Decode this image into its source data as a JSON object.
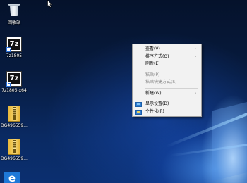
{
  "desktop": {
    "icons": [
      {
        "label": "回收站",
        "icon": "recycle-bin-icon"
      },
      {
        "label": "7z1805",
        "icon": "7zip-icon"
      },
      {
        "label": "7z1805-x64",
        "icon": "7zip-icon"
      },
      {
        "label": "DG496559...",
        "icon": "zip-archive-icon"
      },
      {
        "label": "DG496559...",
        "icon": "zip-archive-icon"
      },
      {
        "label": "",
        "icon": "edge-icon"
      }
    ]
  },
  "context_menu": {
    "items": [
      {
        "label": "查看(V)",
        "submenu": true,
        "disabled": false
      },
      {
        "label": "排序方式(O)",
        "submenu": true,
        "disabled": false
      },
      {
        "label": "刷新(E)",
        "submenu": false,
        "disabled": false
      },
      {
        "label": "粘贴(P)",
        "submenu": false,
        "disabled": true
      },
      {
        "label": "粘贴快捷方式(S)",
        "submenu": false,
        "disabled": true
      },
      {
        "label": "新建(W)",
        "submenu": true,
        "disabled": false
      },
      {
        "label": "显示设置(D)",
        "submenu": false,
        "disabled": false,
        "icon": "display-settings-icon"
      },
      {
        "label": "个性化(R)",
        "submenu": false,
        "disabled": false,
        "icon": "personalize-icon"
      }
    ],
    "arrow_glyph": "›"
  },
  "colors": {
    "desktop_dark": "#05122b",
    "desktop_light": "#0b2f70",
    "menu_bg": "#f2f2f2",
    "menu_disabled": "#8a8a8a",
    "accent": "#2d7dd2"
  }
}
